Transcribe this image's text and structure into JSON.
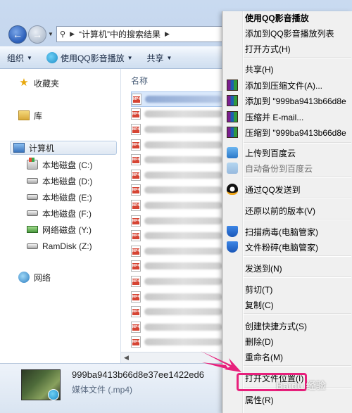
{
  "address_bar": {
    "path": [
      "“计算机”中的搜索结果"
    ]
  },
  "toolbar": {
    "organize": "组织",
    "play_with_qq": "使用QQ影音播放",
    "share": "共享"
  },
  "nav": {
    "favorites": "收藏夹",
    "library": "库",
    "computer": "计算机",
    "drives": [
      {
        "label": "本地磁盘 (C:)",
        "icon": "system-drive-icon"
      },
      {
        "label": "本地磁盘 (D:)",
        "icon": "drive-icon"
      },
      {
        "label": "本地磁盘 (E:)",
        "icon": "drive-icon"
      },
      {
        "label": "本地磁盘 (F:)",
        "icon": "drive-icon"
      },
      {
        "label": "网络磁盘 (Y:)",
        "icon": "network-drive-icon"
      },
      {
        "label": "RamDisk (Z:)",
        "icon": "drive-icon"
      }
    ],
    "network": "网络"
  },
  "file_list": {
    "column_name": "名称",
    "file_icon": "mp4-file-icon",
    "row_count": 18
  },
  "details": {
    "file_name": "999ba9413b66d8e37ee1422ed6",
    "file_type": "媒体文件 (.mp4)"
  },
  "context_menu": {
    "items": [
      {
        "label": "使用QQ影音播放",
        "bold": true
      },
      {
        "label": "添加到QQ影音播放列表"
      },
      {
        "label": "打开方式(H)"
      },
      {
        "label": "共享(H)"
      },
      {
        "label": "添加到压缩文件(A)...",
        "icon": "winrar-icon"
      },
      {
        "label": "添加到 \"999ba9413b66d8e",
        "icon": "winrar-icon"
      },
      {
        "label": "压缩并 E-mail...",
        "icon": "winrar-icon"
      },
      {
        "label": "压缩到 \"999ba9413b66d8e",
        "icon": "winrar-icon"
      },
      {
        "label": "上传到百度云",
        "icon": "baidu-cloud-icon"
      },
      {
        "label": "自动备份到百度云",
        "icon": "baidu-cloud-icon",
        "disabled": true
      },
      {
        "label": "通过QQ发送到",
        "icon": "qq-penguin-icon"
      },
      {
        "label": "还原以前的版本(V)"
      },
      {
        "label": "扫描病毒(电脑管家)",
        "icon": "tencent-shield-icon"
      },
      {
        "label": "文件粉碎(电脑管家)",
        "icon": "tencent-shield-icon"
      },
      {
        "label": "发送到(N)"
      },
      {
        "label": "剪切(T)"
      },
      {
        "label": "复制(C)"
      },
      {
        "label": "创建快捷方式(S)"
      },
      {
        "label": "删除(D)"
      },
      {
        "label": "重命名(M)"
      },
      {
        "label": "打开文件位置(I)",
        "highlighted": true
      },
      {
        "label": "属性(R)"
      }
    ]
  },
  "watermark": "Baidu 经验",
  "colors": {
    "highlight": "#e8207c",
    "menu_bg": "#f0f0f0"
  }
}
